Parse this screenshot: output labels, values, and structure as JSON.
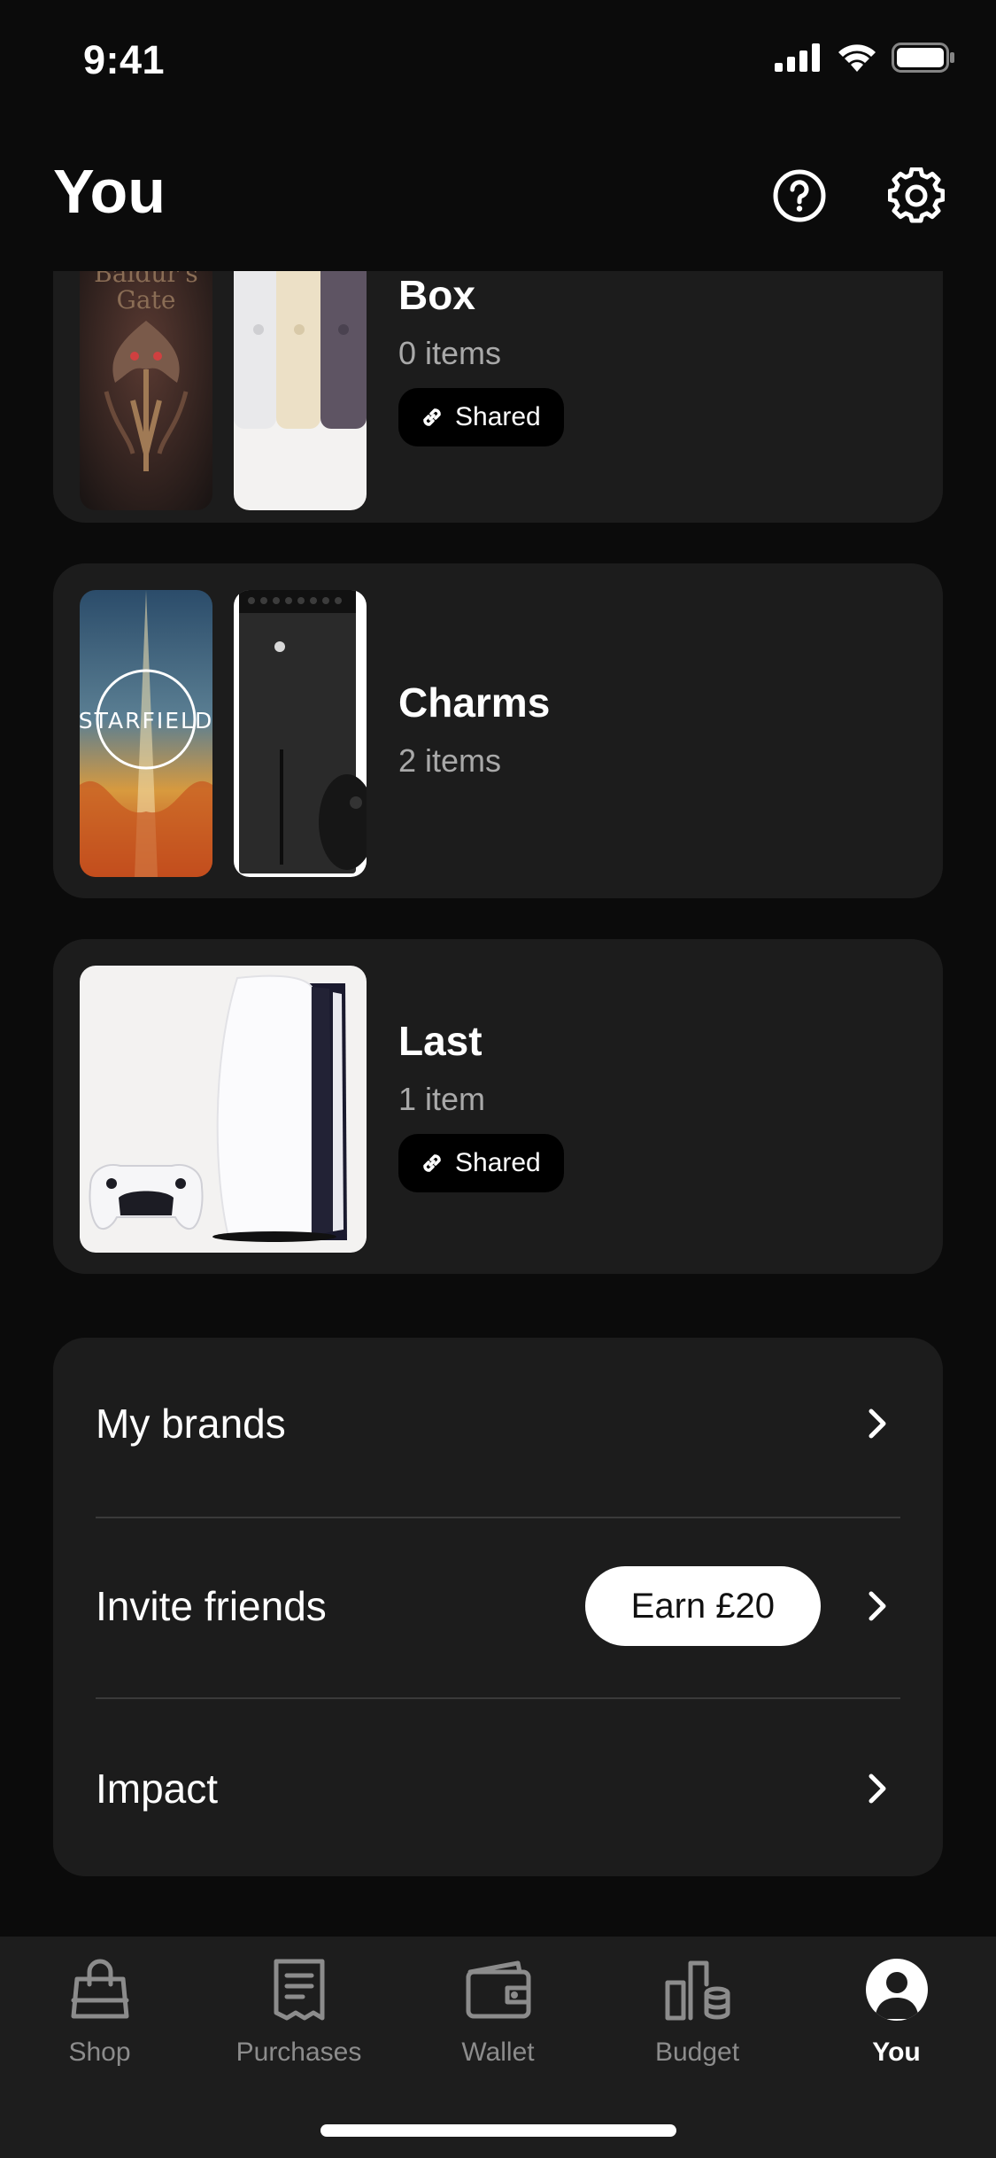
{
  "status_bar": {
    "time": "9:41"
  },
  "header": {
    "title": "You",
    "help_icon": "question-circle-icon",
    "settings_icon": "gear-icon"
  },
  "lists": [
    {
      "name": "Box",
      "count": "0 items",
      "shared_label": "Shared",
      "thumbnails": [
        "baldurs-gate-cover",
        "iphone-colors"
      ],
      "thumb_text": [
        "Baldur's",
        "Gate"
      ]
    },
    {
      "name": "Charms",
      "count": "2 items",
      "thumbnails": [
        "starfield-cover",
        "xbox-console"
      ],
      "thumb_text": [
        "STARFIELD"
      ]
    },
    {
      "name": "Last",
      "count": "1 item",
      "shared_label": "Shared",
      "thumbnails": [
        "ps5-console"
      ]
    }
  ],
  "menu": {
    "items": [
      {
        "label": "My brands"
      },
      {
        "label": "Invite friends",
        "badge": "Earn £20"
      },
      {
        "label": "Impact"
      }
    ]
  },
  "tabs": [
    {
      "label": "Shop",
      "icon": "shopping-bag-icon",
      "active": false
    },
    {
      "label": "Purchases",
      "icon": "receipt-icon",
      "active": false
    },
    {
      "label": "Wallet",
      "icon": "wallet-icon",
      "active": false
    },
    {
      "label": "Budget",
      "icon": "budget-icon",
      "active": false
    },
    {
      "label": "You",
      "icon": "profile-icon",
      "active": true
    }
  ],
  "colors": {
    "background": "#0b0b0b",
    "card": "#1c1c1c",
    "tab_bar": "#1d1d1d",
    "muted_text": "#a9a9a9",
    "inactive_tab": "#8c8c8c"
  }
}
